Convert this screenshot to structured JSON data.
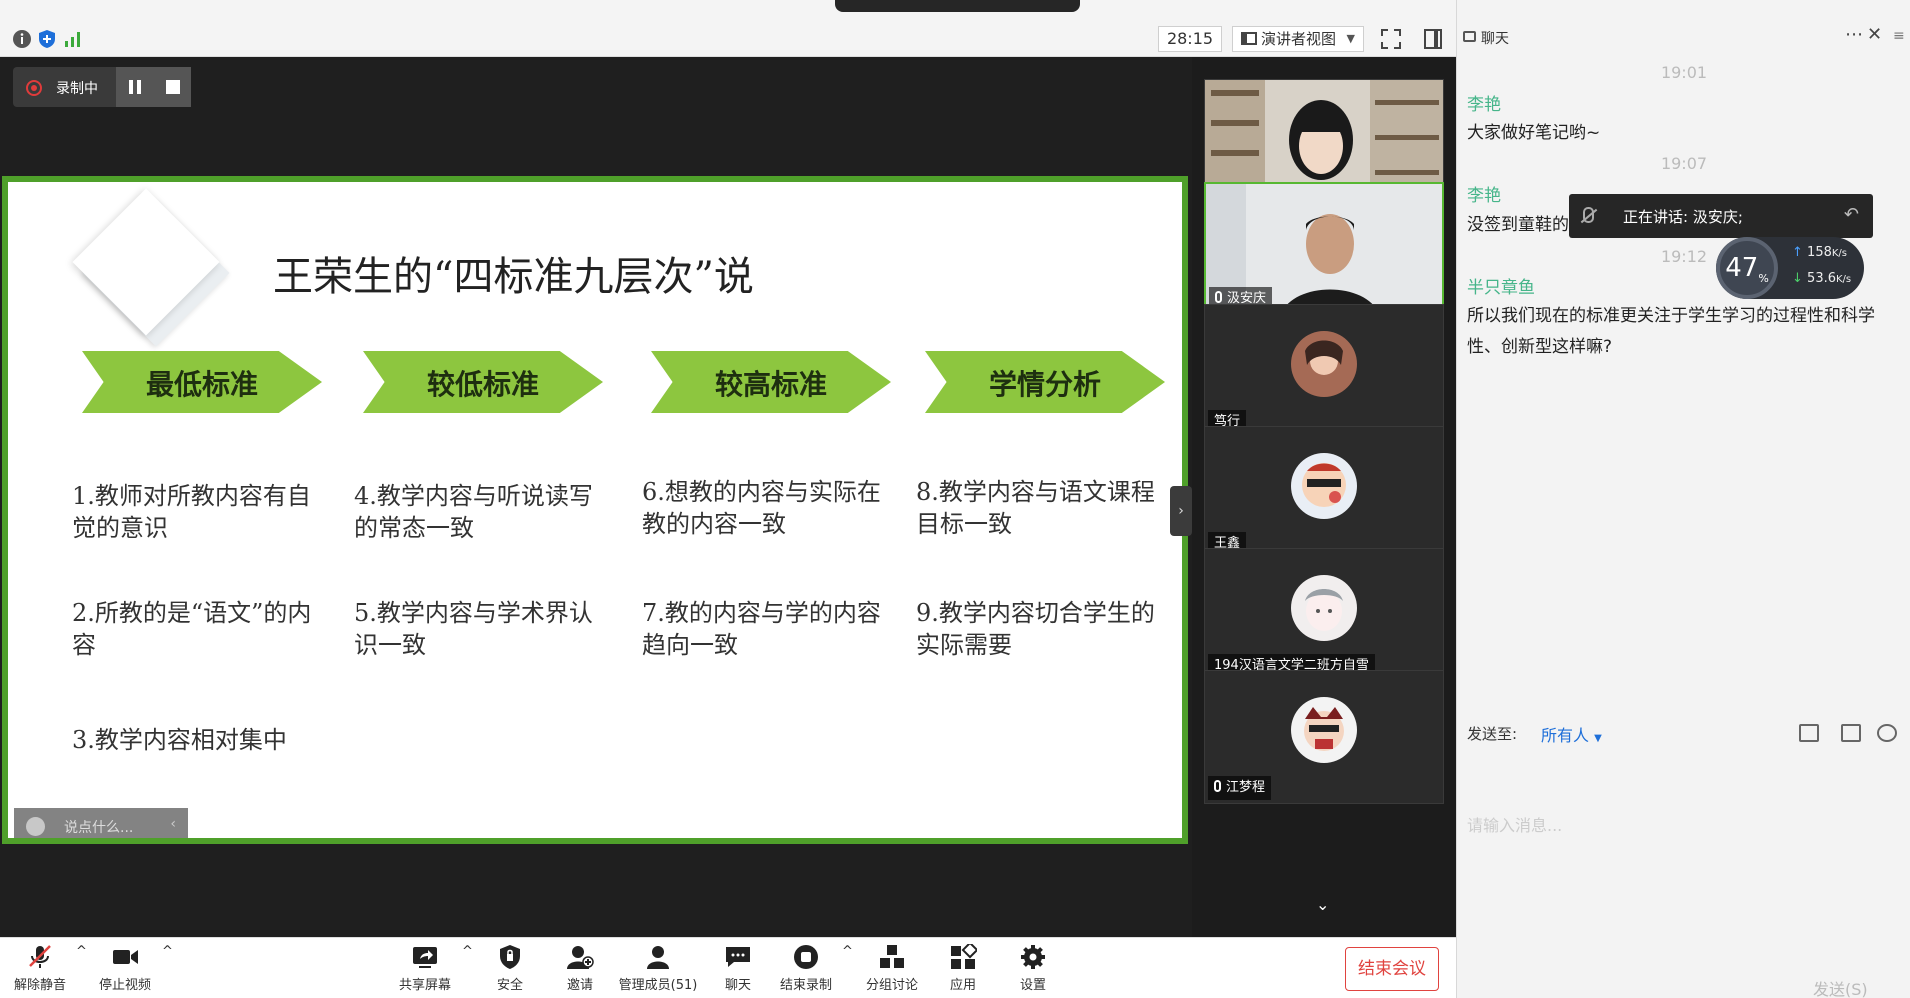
{
  "meeting": {
    "timer": "28:15",
    "view_mode": "演讲者视图",
    "recording_label": "录制中"
  },
  "slide": {
    "title": "王荣生的“四标准九层次”说",
    "banners": [
      "最低标准",
      "较低标准",
      "较高标准",
      "学情分析"
    ],
    "items": [
      "1.教师对所教内容有自觉的意识",
      "2.所教的是“语文”的内容",
      "3.教学内容相对集中",
      "4.教学内容与听说读写的常态一致",
      "5.教学内容与学术界认识一致",
      "6.想教的内容与实际在教的内容一致",
      "7.教的内容与学的内容趋向一致",
      "8.教学内容与语文课程目标一致",
      "9.教学内容切合学生的实际需要"
    ],
    "say_placeholder": "说点什么..."
  },
  "participants": [
    {
      "name": "李艳"
    },
    {
      "name": "汲安庆"
    },
    {
      "name": "笃行"
    },
    {
      "name": "王鑫"
    },
    {
      "name": "194汉语言文学二班方自雪"
    },
    {
      "name": "江梦程"
    }
  ],
  "toolbar": {
    "unmute": "解除静音",
    "stop_video": "停止视频",
    "share_screen": "共享屏幕",
    "security": "安全",
    "invite": "邀请",
    "manage_members": "管理成员(51)",
    "chat": "聊天",
    "end_recording": "结束录制",
    "breakout": "分组讨论",
    "apps": "应用",
    "settings": "设置",
    "end_meeting": "结束会议"
  },
  "chat": {
    "title": "聊天",
    "messages": [
      {
        "time": "19:01",
        "sender": "李艳",
        "text": "大家做好笔记哟~"
      },
      {
        "time": "19:07",
        "sender": "李艳",
        "text": "没签到童鞋的"
      },
      {
        "time": "19:12",
        "sender": "半只章鱼",
        "text": "所以我们现在的标准更关注于学生学习的过程性和科学性、创新型这样嘛?"
      }
    ],
    "send_to_label": "发送至:",
    "send_to_value": "所有人",
    "input_placeholder": "请输入消息...",
    "send_label": "发送(S)"
  },
  "speaking": {
    "label": "正在讲话: 汲安庆;"
  },
  "network": {
    "cpu": "47",
    "cpu_unit": "%",
    "upload": "158",
    "download": "53.6",
    "speed_unit": "K/s"
  },
  "colors": {
    "slide_border": "#4fa02a",
    "banner": "#8dc63f",
    "end_meeting": "#e0433f",
    "chat_sender": "#46b58a",
    "link_blue": "#1e6fd9"
  },
  "icons": [
    "info-icon",
    "shield-icon",
    "signal-icon",
    "mic-muted-icon",
    "video-icon",
    "share-screen-icon",
    "security-icon",
    "invite-icon",
    "members-icon",
    "chat-icon",
    "record-stop-icon",
    "breakout-icon",
    "apps-icon",
    "gear-icon"
  ]
}
